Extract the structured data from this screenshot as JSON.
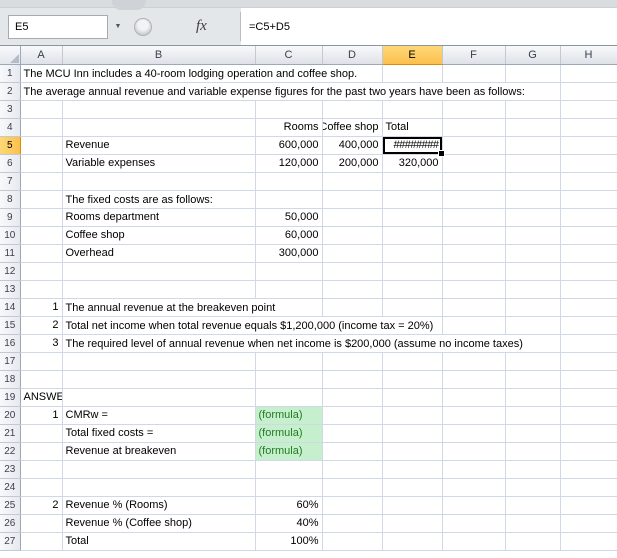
{
  "formula_bar": {
    "name_box_value": "E5",
    "fx_label": "fx",
    "formula": "=C5+D5"
  },
  "icons": {
    "chevron_down": "▼"
  },
  "colors": {
    "selection_accent": "#FBC04D",
    "selection_border": "#DB8B11",
    "highlight_green_bg": "#C6EFCE",
    "highlight_green_text": "#237A23",
    "gridline": "#D0D7E5"
  },
  "sheet": {
    "columns": [
      "A",
      "B",
      "C",
      "D",
      "E",
      "F",
      "G",
      "H"
    ],
    "row_count": 27,
    "selected": {
      "cell": "E5",
      "column": "E",
      "row": 5
    },
    "cells": {
      "A1": {
        "text": "The MCU Inn includes a 40-room lodging operation and coffee shop.",
        "spill": true
      },
      "A2": {
        "text": "The average annual revenue and variable expense figures for the past two years have been as follows:",
        "spill": true
      },
      "C4": {
        "text": "Rooms",
        "align": "right"
      },
      "D4": {
        "text": "Coffee shop",
        "align": "right",
        "clip": "left"
      },
      "E4": {
        "text": "Total"
      },
      "B5": {
        "text": "Revenue"
      },
      "C5": {
        "text": "600,000",
        "align": "right"
      },
      "D5": {
        "text": "400,000",
        "align": "right"
      },
      "E5": {
        "text": "########",
        "align": "right"
      },
      "B6": {
        "text": "Variable expenses"
      },
      "C6": {
        "text": "120,000",
        "align": "right"
      },
      "D6": {
        "text": "200,000",
        "align": "right"
      },
      "E6": {
        "text": "320,000",
        "align": "right"
      },
      "B8": {
        "text": "The fixed costs are as follows:",
        "spill": true
      },
      "B9": {
        "text": "Rooms department"
      },
      "C9": {
        "text": "50,000",
        "align": "right"
      },
      "B10": {
        "text": "Coffee shop"
      },
      "C10": {
        "text": "60,000",
        "align": "right"
      },
      "B11": {
        "text": "Overhead"
      },
      "C11": {
        "text": "300,000",
        "align": "right"
      },
      "A14": {
        "text": "1",
        "align": "right"
      },
      "B14": {
        "text": "The annual revenue at the breakeven point",
        "spill": true
      },
      "A15": {
        "text": "2",
        "align": "right"
      },
      "B15": {
        "text": "Total net income when total revenue equals $1,200,000 (income tax = 20%)",
        "spill": true
      },
      "A16": {
        "text": "3",
        "align": "right"
      },
      "B16": {
        "text": "The required level of annual revenue when net income is $200,000 (assume no income taxes)",
        "spill": true
      },
      "A19": {
        "text": "ANSWER"
      },
      "A20": {
        "text": "1",
        "align": "right"
      },
      "B20": {
        "text": "CMRw ="
      },
      "C20": {
        "text": "(formula)",
        "style": "green"
      },
      "B21": {
        "text": "Total fixed costs ="
      },
      "C21": {
        "text": "(formula)",
        "style": "green"
      },
      "B22": {
        "text": "Revenue at breakeven"
      },
      "C22": {
        "text": "(formula)",
        "style": "green"
      },
      "A25": {
        "text": "2",
        "align": "right"
      },
      "B25": {
        "text": "Revenue % (Rooms)"
      },
      "C25": {
        "text": "60%",
        "align": "right"
      },
      "B26": {
        "text": "Revenue % (Coffee shop)"
      },
      "C26": {
        "text": "40%",
        "align": "right"
      },
      "B27": {
        "text": "Total"
      },
      "C27": {
        "text": "100%",
        "align": "right"
      }
    }
  }
}
